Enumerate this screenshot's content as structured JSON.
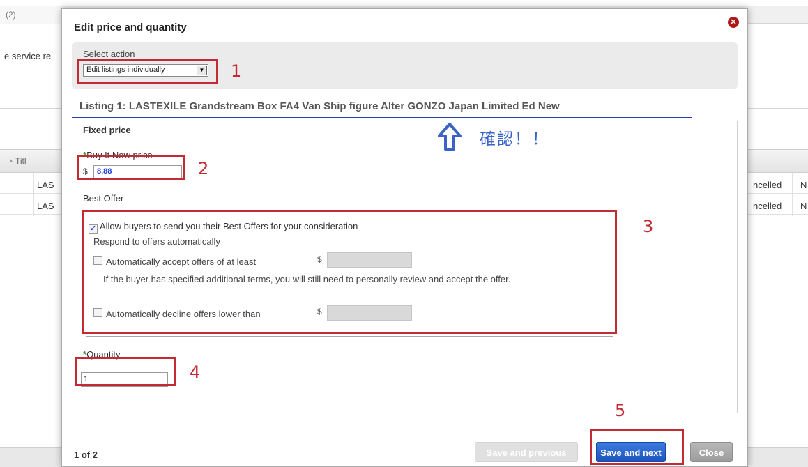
{
  "background": {
    "tab_label": "(2)",
    "service_text": "e service re",
    "table_header_title": "Titl",
    "rows": [
      {
        "title": "LAS",
        "status": "ncelled",
        "extra": "N"
      },
      {
        "title": "LAS",
        "status": "ncelled",
        "extra": "N"
      }
    ]
  },
  "modal": {
    "title": "Edit price and quantity",
    "select_action_label": "Select action",
    "select_action_value": "Edit listings individually",
    "listing_title": "Listing 1: LASTEXILE Grandstream Box FA4 Van Ship figure Alter GONZO Japan Limited Ed New",
    "fixed_price_label": "Fixed price",
    "bin_label": "Buy It Now price",
    "currency": "$",
    "bin_value": "8.88",
    "best_offer_label": "Best Offer",
    "allow_offers_label": "Allow buyers to send you their Best Offers for your consideration",
    "respond_label": "Respond to offers automatically",
    "auto_accept_label": "Automatically accept offers of at least",
    "auto_accept_note": "If the buyer has specified additional terms, you will still need to personally review and accept the offer.",
    "auto_decline_label": "Automatically decline offers lower than",
    "quantity_label": "Quantity",
    "quantity_value": "1",
    "page_count": "1 of 2",
    "btn_prev": "Save and previous",
    "btn_next": "Save and next",
    "btn_close": "Close"
  },
  "annotations": {
    "n1": "1",
    "n2": "2",
    "n3": "3",
    "n4": "4",
    "n5": "5",
    "kakunin": "確認！！"
  },
  "colors": {
    "annotation_red": "#c42a33",
    "underline_blue": "#2a3da8",
    "primary_blue": "#1c55bc"
  }
}
